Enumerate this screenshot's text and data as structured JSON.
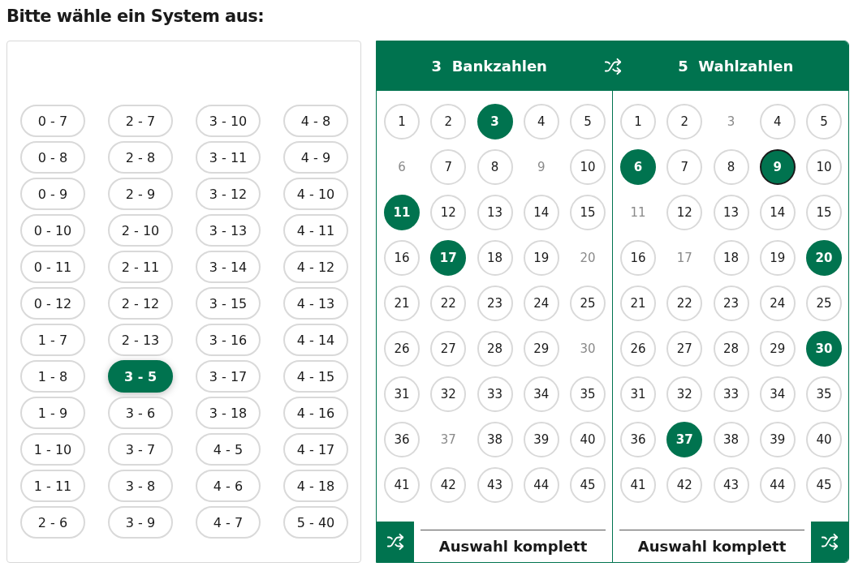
{
  "title": "Bitte wähle ein System aus:",
  "systems": [
    {
      "label": "0 - 7",
      "selected": false
    },
    {
      "label": "0 - 8",
      "selected": false
    },
    {
      "label": "0 - 9",
      "selected": false
    },
    {
      "label": "0 - 10",
      "selected": false
    },
    {
      "label": "0 - 11",
      "selected": false
    },
    {
      "label": "0 - 12",
      "selected": false
    },
    {
      "label": "1 - 7",
      "selected": false
    },
    {
      "label": "1 - 8",
      "selected": false
    },
    {
      "label": "1 - 9",
      "selected": false
    },
    {
      "label": "1 - 10",
      "selected": false
    },
    {
      "label": "1 - 11",
      "selected": false
    },
    {
      "label": "2 - 6",
      "selected": false
    },
    {
      "label": "2 - 7",
      "selected": false
    },
    {
      "label": "2 - 8",
      "selected": false
    },
    {
      "label": "2 - 9",
      "selected": false
    },
    {
      "label": "2 - 10",
      "selected": false
    },
    {
      "label": "2 - 11",
      "selected": false
    },
    {
      "label": "2 - 12",
      "selected": false
    },
    {
      "label": "2 - 13",
      "selected": false
    },
    {
      "label": "3 - 5",
      "selected": true
    },
    {
      "label": "3 - 6",
      "selected": false
    },
    {
      "label": "3 - 7",
      "selected": false
    },
    {
      "label": "3 - 8",
      "selected": false
    },
    {
      "label": "3 - 9",
      "selected": false
    },
    {
      "label": "3 - 10",
      "selected": false
    },
    {
      "label": "3 - 11",
      "selected": false
    },
    {
      "label": "3 - 12",
      "selected": false
    },
    {
      "label": "3 - 13",
      "selected": false
    },
    {
      "label": "3 - 14",
      "selected": false
    },
    {
      "label": "3 - 15",
      "selected": false
    },
    {
      "label": "3 - 16",
      "selected": false
    },
    {
      "label": "3 - 17",
      "selected": false
    },
    {
      "label": "3 - 18",
      "selected": false
    },
    {
      "label": "4 - 5",
      "selected": false
    },
    {
      "label": "4 - 6",
      "selected": false
    },
    {
      "label": "4 - 7",
      "selected": false
    },
    {
      "label": "4 - 8",
      "selected": false
    },
    {
      "label": "4 - 9",
      "selected": false
    },
    {
      "label": "4 - 10",
      "selected": false
    },
    {
      "label": "4 - 11",
      "selected": false
    },
    {
      "label": "4 - 12",
      "selected": false
    },
    {
      "label": "4 - 13",
      "selected": false
    },
    {
      "label": "4 - 14",
      "selected": false
    },
    {
      "label": "4 - 15",
      "selected": false
    },
    {
      "label": "4 - 16",
      "selected": false
    },
    {
      "label": "4 - 17",
      "selected": false
    },
    {
      "label": "4 - 18",
      "selected": false
    },
    {
      "label": "5 - 40",
      "selected": false
    }
  ],
  "panels": [
    {
      "count": "3",
      "heading": "Bankzahlen",
      "footer": "Auswahl komplett",
      "numbers": [
        {
          "n": "1",
          "selected": false,
          "disabled": false,
          "focused": false
        },
        {
          "n": "2",
          "selected": false,
          "disabled": false,
          "focused": false
        },
        {
          "n": "3",
          "selected": true,
          "disabled": false,
          "focused": false
        },
        {
          "n": "4",
          "selected": false,
          "disabled": false,
          "focused": false
        },
        {
          "n": "5",
          "selected": false,
          "disabled": false,
          "focused": false
        },
        {
          "n": "6",
          "selected": false,
          "disabled": true,
          "focused": false
        },
        {
          "n": "7",
          "selected": false,
          "disabled": false,
          "focused": false
        },
        {
          "n": "8",
          "selected": false,
          "disabled": false,
          "focused": false
        },
        {
          "n": "9",
          "selected": false,
          "disabled": true,
          "focused": false
        },
        {
          "n": "10",
          "selected": false,
          "disabled": false,
          "focused": false
        },
        {
          "n": "11",
          "selected": true,
          "disabled": false,
          "focused": false
        },
        {
          "n": "12",
          "selected": false,
          "disabled": false,
          "focused": false
        },
        {
          "n": "13",
          "selected": false,
          "disabled": false,
          "focused": false
        },
        {
          "n": "14",
          "selected": false,
          "disabled": false,
          "focused": false
        },
        {
          "n": "15",
          "selected": false,
          "disabled": false,
          "focused": false
        },
        {
          "n": "16",
          "selected": false,
          "disabled": false,
          "focused": false
        },
        {
          "n": "17",
          "selected": true,
          "disabled": false,
          "focused": false
        },
        {
          "n": "18",
          "selected": false,
          "disabled": false,
          "focused": false
        },
        {
          "n": "19",
          "selected": false,
          "disabled": false,
          "focused": false
        },
        {
          "n": "20",
          "selected": false,
          "disabled": true,
          "focused": false
        },
        {
          "n": "21",
          "selected": false,
          "disabled": false,
          "focused": false
        },
        {
          "n": "22",
          "selected": false,
          "disabled": false,
          "focused": false
        },
        {
          "n": "23",
          "selected": false,
          "disabled": false,
          "focused": false
        },
        {
          "n": "24",
          "selected": false,
          "disabled": false,
          "focused": false
        },
        {
          "n": "25",
          "selected": false,
          "disabled": false,
          "focused": false
        },
        {
          "n": "26",
          "selected": false,
          "disabled": false,
          "focused": false
        },
        {
          "n": "27",
          "selected": false,
          "disabled": false,
          "focused": false
        },
        {
          "n": "28",
          "selected": false,
          "disabled": false,
          "focused": false
        },
        {
          "n": "29",
          "selected": false,
          "disabled": false,
          "focused": false
        },
        {
          "n": "30",
          "selected": false,
          "disabled": true,
          "focused": false
        },
        {
          "n": "31",
          "selected": false,
          "disabled": false,
          "focused": false
        },
        {
          "n": "32",
          "selected": false,
          "disabled": false,
          "focused": false
        },
        {
          "n": "33",
          "selected": false,
          "disabled": false,
          "focused": false
        },
        {
          "n": "34",
          "selected": false,
          "disabled": false,
          "focused": false
        },
        {
          "n": "35",
          "selected": false,
          "disabled": false,
          "focused": false
        },
        {
          "n": "36",
          "selected": false,
          "disabled": false,
          "focused": false
        },
        {
          "n": "37",
          "selected": false,
          "disabled": true,
          "focused": false
        },
        {
          "n": "38",
          "selected": false,
          "disabled": false,
          "focused": false
        },
        {
          "n": "39",
          "selected": false,
          "disabled": false,
          "focused": false
        },
        {
          "n": "40",
          "selected": false,
          "disabled": false,
          "focused": false
        },
        {
          "n": "41",
          "selected": false,
          "disabled": false,
          "focused": false
        },
        {
          "n": "42",
          "selected": false,
          "disabled": false,
          "focused": false
        },
        {
          "n": "43",
          "selected": false,
          "disabled": false,
          "focused": false
        },
        {
          "n": "44",
          "selected": false,
          "disabled": false,
          "focused": false
        },
        {
          "n": "45",
          "selected": false,
          "disabled": false,
          "focused": false
        }
      ]
    },
    {
      "count": "5",
      "heading": "Wahlzahlen",
      "footer": "Auswahl komplett",
      "numbers": [
        {
          "n": "1",
          "selected": false,
          "disabled": false,
          "focused": false
        },
        {
          "n": "2",
          "selected": false,
          "disabled": false,
          "focused": false
        },
        {
          "n": "3",
          "selected": false,
          "disabled": true,
          "focused": false
        },
        {
          "n": "4",
          "selected": false,
          "disabled": false,
          "focused": false
        },
        {
          "n": "5",
          "selected": false,
          "disabled": false,
          "focused": false
        },
        {
          "n": "6",
          "selected": true,
          "disabled": false,
          "focused": false
        },
        {
          "n": "7",
          "selected": false,
          "disabled": false,
          "focused": false
        },
        {
          "n": "8",
          "selected": false,
          "disabled": false,
          "focused": false
        },
        {
          "n": "9",
          "selected": true,
          "disabled": false,
          "focused": true
        },
        {
          "n": "10",
          "selected": false,
          "disabled": false,
          "focused": false
        },
        {
          "n": "11",
          "selected": false,
          "disabled": true,
          "focused": false
        },
        {
          "n": "12",
          "selected": false,
          "disabled": false,
          "focused": false
        },
        {
          "n": "13",
          "selected": false,
          "disabled": false,
          "focused": false
        },
        {
          "n": "14",
          "selected": false,
          "disabled": false,
          "focused": false
        },
        {
          "n": "15",
          "selected": false,
          "disabled": false,
          "focused": false
        },
        {
          "n": "16",
          "selected": false,
          "disabled": false,
          "focused": false
        },
        {
          "n": "17",
          "selected": false,
          "disabled": true,
          "focused": false
        },
        {
          "n": "18",
          "selected": false,
          "disabled": false,
          "focused": false
        },
        {
          "n": "19",
          "selected": false,
          "disabled": false,
          "focused": false
        },
        {
          "n": "20",
          "selected": true,
          "disabled": false,
          "focused": false
        },
        {
          "n": "21",
          "selected": false,
          "disabled": false,
          "focused": false
        },
        {
          "n": "22",
          "selected": false,
          "disabled": false,
          "focused": false
        },
        {
          "n": "23",
          "selected": false,
          "disabled": false,
          "focused": false
        },
        {
          "n": "24",
          "selected": false,
          "disabled": false,
          "focused": false
        },
        {
          "n": "25",
          "selected": false,
          "disabled": false,
          "focused": false
        },
        {
          "n": "26",
          "selected": false,
          "disabled": false,
          "focused": false
        },
        {
          "n": "27",
          "selected": false,
          "disabled": false,
          "focused": false
        },
        {
          "n": "28",
          "selected": false,
          "disabled": false,
          "focused": false
        },
        {
          "n": "29",
          "selected": false,
          "disabled": false,
          "focused": false
        },
        {
          "n": "30",
          "selected": true,
          "disabled": false,
          "focused": false
        },
        {
          "n": "31",
          "selected": false,
          "disabled": false,
          "focused": false
        },
        {
          "n": "32",
          "selected": false,
          "disabled": false,
          "focused": false
        },
        {
          "n": "33",
          "selected": false,
          "disabled": false,
          "focused": false
        },
        {
          "n": "34",
          "selected": false,
          "disabled": false,
          "focused": false
        },
        {
          "n": "35",
          "selected": false,
          "disabled": false,
          "focused": false
        },
        {
          "n": "36",
          "selected": false,
          "disabled": false,
          "focused": false
        },
        {
          "n": "37",
          "selected": true,
          "disabled": false,
          "focused": false
        },
        {
          "n": "38",
          "selected": false,
          "disabled": false,
          "focused": false
        },
        {
          "n": "39",
          "selected": false,
          "disabled": false,
          "focused": false
        },
        {
          "n": "40",
          "selected": false,
          "disabled": false,
          "focused": false
        },
        {
          "n": "41",
          "selected": false,
          "disabled": false,
          "focused": false
        },
        {
          "n": "42",
          "selected": false,
          "disabled": false,
          "focused": false
        },
        {
          "n": "43",
          "selected": false,
          "disabled": false,
          "focused": false
        },
        {
          "n": "44",
          "selected": false,
          "disabled": false,
          "focused": false
        },
        {
          "n": "45",
          "selected": false,
          "disabled": false,
          "focused": false
        }
      ]
    }
  ]
}
